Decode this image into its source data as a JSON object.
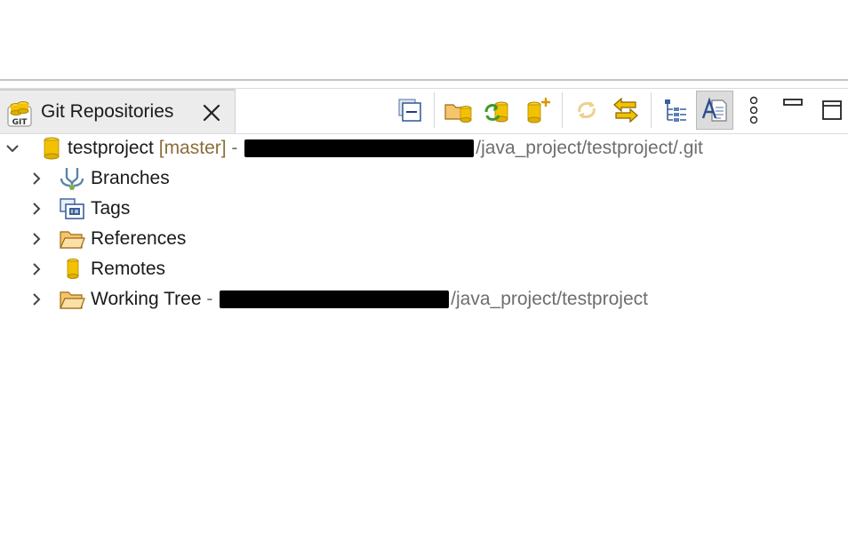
{
  "view": {
    "tab_title": "Git Repositories",
    "tab_icon_text": "GIT"
  },
  "toolbar": {
    "items": [
      "collapse-all",
      "add-existing-repository",
      "clone-repository",
      "create-repository",
      "refresh",
      "link-with-selection",
      "hierarchical-branch-layout",
      "show-label-details",
      "view-menu",
      "minimize",
      "maximize"
    ]
  },
  "repository": {
    "name": "testproject",
    "branch": "[master]",
    "separator": " - ",
    "path_suffix": "/java_project/testproject/.git"
  },
  "nodes": [
    {
      "label": "Branches"
    },
    {
      "label": "Tags"
    },
    {
      "label": "References"
    },
    {
      "label": "Remotes"
    },
    {
      "label": "Working Tree",
      "separator": " - ",
      "path_suffix": "/java_project/testproject"
    }
  ],
  "colors": {
    "branch": "#8a6d3b",
    "path": "#6e6e6e",
    "repo_icon": "#f2c200"
  }
}
